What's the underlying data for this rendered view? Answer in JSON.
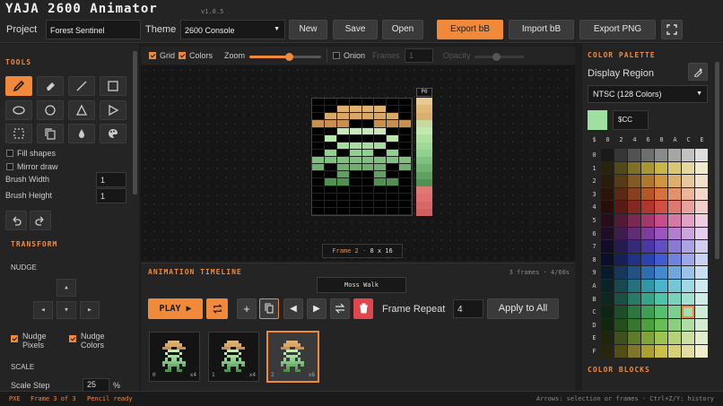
{
  "app": {
    "title": "YAJA 2600 Animator",
    "version": "v1.0.5"
  },
  "toolbar": {
    "project_label": "Project",
    "project_value": "Forest Sentinel",
    "theme_label": "Theme",
    "theme_value": "2600 Console",
    "new": "New",
    "save": "Save",
    "open": "Open",
    "export_bb": "Export bB",
    "import_bb": "Import bB",
    "export_png": "Export PNG"
  },
  "tools": {
    "title": "TOOLS",
    "items": [
      "pencil-icon",
      "eraser-icon",
      "line-icon",
      "rect-icon",
      "ellipse-icon",
      "circle-icon",
      "triangle-icon",
      "play-shape-icon",
      "select-icon",
      "copy-icon",
      "fill-icon",
      "palette-icon"
    ],
    "fill_shapes": "Fill shapes",
    "mirror_draw": "Mirror draw",
    "brush_width_label": "Brush Width",
    "brush_width": "1",
    "brush_height_label": "Brush Height",
    "brush_height": "1"
  },
  "transform": {
    "title": "TRANSFORM",
    "nudge": "NUDGE",
    "nudge_pixels": "Nudge\nPixels",
    "nudge_colors": "Nudge\nColors",
    "scale": "SCALE",
    "scale_step_label": "Scale Step",
    "scale_step": "25",
    "scale_unit": "%"
  },
  "view": {
    "grid": "Grid",
    "colors": "Colors",
    "zoom": "Zoom",
    "zoom_level": 0.55,
    "onion": "Onion",
    "frames": "Frames",
    "frames_value": "1",
    "opacity": "Opacity"
  },
  "canvas": {
    "pf_label": "P0",
    "frame_label": "Frame 2",
    "size": "8 x 16"
  },
  "timeline": {
    "title": "ANIMATION TIMELINE",
    "info": "3 frames · 4/60s",
    "name": "Moss Walk",
    "play": "PLAY ▶",
    "frame_repeat_label": "Frame Repeat",
    "frame_repeat": "4",
    "apply_all": "Apply to All",
    "frames": [
      {
        "index": "0",
        "repeat": "x4"
      },
      {
        "index": "1",
        "repeat": "x4"
      },
      {
        "index": "2",
        "repeat": "x6"
      }
    ]
  },
  "palette": {
    "title": "COLOR PALETTE",
    "display_region": "Display Region",
    "region_value": "NTSC (128 Colors)",
    "selected_hex": "$CC",
    "selected_color": "#9fe0a0",
    "col_headers": [
      "$",
      "0",
      "2",
      "4",
      "6",
      "8",
      "A",
      "C",
      "E"
    ],
    "row_headers": [
      "0",
      "1",
      "2",
      "3",
      "4",
      "5",
      "6",
      "7",
      "8",
      "9",
      "A",
      "B",
      "C",
      "D",
      "E",
      "F"
    ],
    "blocks_title": "COLOR BLOCKS"
  },
  "status": {
    "left": "PXE",
    "frame": "Frame 3 of 3",
    "tool": "Pencil ready",
    "hint": "Arrows: selection or frames · Ctrl+Z/Y: history"
  },
  "colors": {
    "accent": "#f08a3a",
    "bg": "#1d1d1d",
    "panel": "#242424"
  }
}
